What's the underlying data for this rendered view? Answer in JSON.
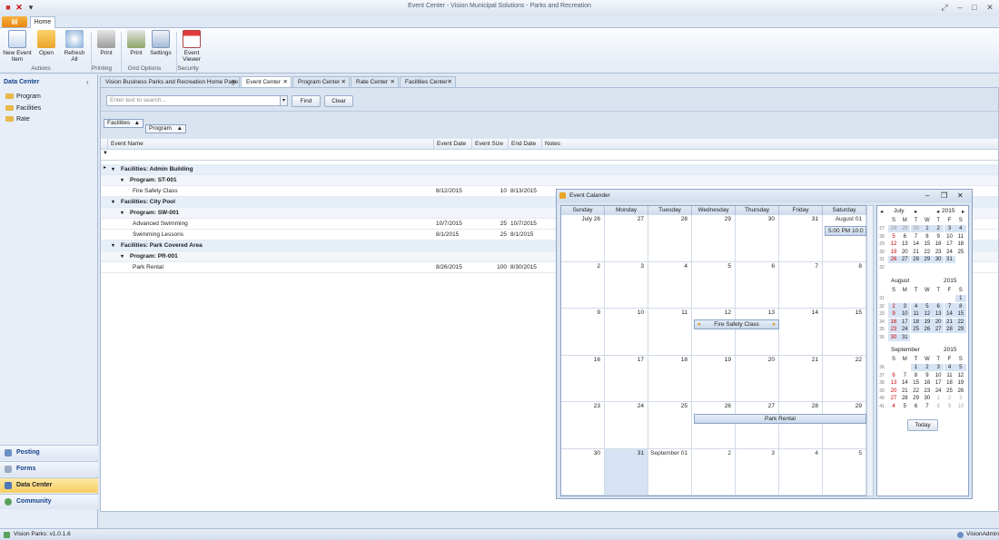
{
  "window": {
    "title": "Event Center - Vision Municipal Solutions - Parks and Recreation"
  },
  "ribbon": {
    "tab_home": "Home",
    "buttons": [
      {
        "label": "New Event\nItem"
      },
      {
        "label": "Open"
      },
      {
        "label": "Refresh\nAll"
      },
      {
        "label": "Print"
      },
      {
        "label": "Print"
      },
      {
        "label": "Settings"
      },
      {
        "label": "Event\nViewer"
      }
    ],
    "groups": [
      "Actions",
      "Printing",
      "Grid Options",
      "Security"
    ]
  },
  "sidebar": {
    "title": "Data Center",
    "items": [
      "Program",
      "Facilities",
      "Rate"
    ],
    "nav": [
      "Posting",
      "Forms",
      "Data Center",
      "Community"
    ]
  },
  "tabs": [
    "Vision Business Parks and Recreation Home Page",
    "Event Center",
    "Program Center",
    "Rate Center",
    "Facilities Center"
  ],
  "search": {
    "placeholder": "Enter text to search...",
    "find": "Find",
    "clear": "Clear"
  },
  "grouping": {
    "chip1": "Facilities",
    "chip2": "Program"
  },
  "grid": {
    "columns": [
      "Event Name",
      "Event Date",
      "Event Size",
      "End Date",
      "Notes"
    ],
    "rows": [
      {
        "type": "g1",
        "text": "Facilities: Admin Building"
      },
      {
        "type": "g2",
        "text": "Program: ST-001"
      },
      {
        "type": "d",
        "name": "Fire Safety Class",
        "date": "8/12/2015",
        "size": "10",
        "end": "8/13/2015"
      },
      {
        "type": "g1",
        "text": "Facilities: City Pool"
      },
      {
        "type": "g2",
        "text": "Program: SW-001"
      },
      {
        "type": "d",
        "name": "Advanced Swimming",
        "date": "10/7/2015",
        "size": "25",
        "end": "10/7/2015"
      },
      {
        "type": "d",
        "name": "Swimming Lessons",
        "date": "8/1/2015",
        "size": "25",
        "end": "8/1/2015"
      },
      {
        "type": "g1",
        "text": "Facilities: Park Covered Area"
      },
      {
        "type": "g2",
        "text": "Program: PR-001"
      },
      {
        "type": "d",
        "name": "Park Rental",
        "date": "8/26/2015",
        "size": "100",
        "end": "8/30/2015"
      }
    ]
  },
  "calendar": {
    "title": "Event Calander",
    "weekdays": [
      "Sunday",
      "Monday",
      "Tuesday",
      "Wednesday",
      "Thursday",
      "Friday",
      "Saturday"
    ],
    "weeks": [
      [
        "July 26",
        "27",
        "28",
        "29",
        "30",
        "31",
        "August 01"
      ],
      [
        "2",
        "3",
        "4",
        "5",
        "6",
        "7",
        "8"
      ],
      [
        "9",
        "10",
        "11",
        "12",
        "13",
        "14",
        "15"
      ],
      [
        "16",
        "17",
        "18",
        "19",
        "20",
        "21",
        "22"
      ],
      [
        "23",
        "24",
        "25",
        "26",
        "27",
        "28",
        "29"
      ],
      [
        "30",
        "31",
        "September 01",
        "2",
        "3",
        "4",
        "5"
      ]
    ],
    "appointments": {
      "time": "5:00 PM 10:0",
      "fire": "Fire Safety Class",
      "park": "Park Rental"
    },
    "mini": {
      "dow": [
        "S",
        "M",
        "T",
        "W",
        "T",
        "F",
        "S"
      ],
      "months": [
        {
          "name": "July",
          "year": "2015",
          "weeks": [
            "27",
            "28",
            "29",
            "30",
            "31",
            "32"
          ],
          "days": [
            [
              "28",
              "29",
              "30",
              "1",
              "2",
              "3",
              "4"
            ],
            [
              "5",
              "6",
              "7",
              "8",
              "9",
              "10",
              "11"
            ],
            [
              "12",
              "13",
              "14",
              "15",
              "16",
              "17",
              "18"
            ],
            [
              "19",
              "20",
              "21",
              "22",
              "23",
              "24",
              "25"
            ],
            [
              "26",
              "27",
              "28",
              "29",
              "30",
              "31",
              ""
            ]
          ]
        },
        {
          "name": "August",
          "year": "2015",
          "weeks": [
            "31",
            "32",
            "33",
            "34",
            "35",
            "36"
          ],
          "days": [
            [
              "",
              "",
              "",
              "",
              "",
              "",
              "1"
            ],
            [
              "2",
              "3",
              "4",
              "5",
              "6",
              "7",
              "8"
            ],
            [
              "9",
              "10",
              "11",
              "12",
              "13",
              "14",
              "15"
            ],
            [
              "16",
              "17",
              "18",
              "19",
              "20",
              "21",
              "22"
            ],
            [
              "23",
              "24",
              "25",
              "26",
              "27",
              "28",
              "29"
            ],
            [
              "30",
              "31",
              "",
              "",
              "",
              "",
              ""
            ]
          ]
        },
        {
          "name": "September",
          "year": "2015",
          "weeks": [
            "36",
            "37",
            "38",
            "39",
            "40",
            "41"
          ],
          "days": [
            [
              "",
              "",
              "1",
              "2",
              "3",
              "4",
              "5"
            ],
            [
              "6",
              "7",
              "8",
              "9",
              "10",
              "11",
              "12"
            ],
            [
              "13",
              "14",
              "15",
              "16",
              "17",
              "18",
              "19"
            ],
            [
              "20",
              "21",
              "22",
              "23",
              "24",
              "25",
              "26"
            ],
            [
              "27",
              "28",
              "29",
              "30",
              "1",
              "2",
              "3"
            ],
            [
              "4",
              "5",
              "6",
              "7",
              "8",
              "9",
              "10"
            ]
          ]
        }
      ],
      "today": "Today"
    }
  },
  "status": {
    "version": "Vision Parks: v1.0.1.6",
    "user": "VisionAdmin"
  }
}
